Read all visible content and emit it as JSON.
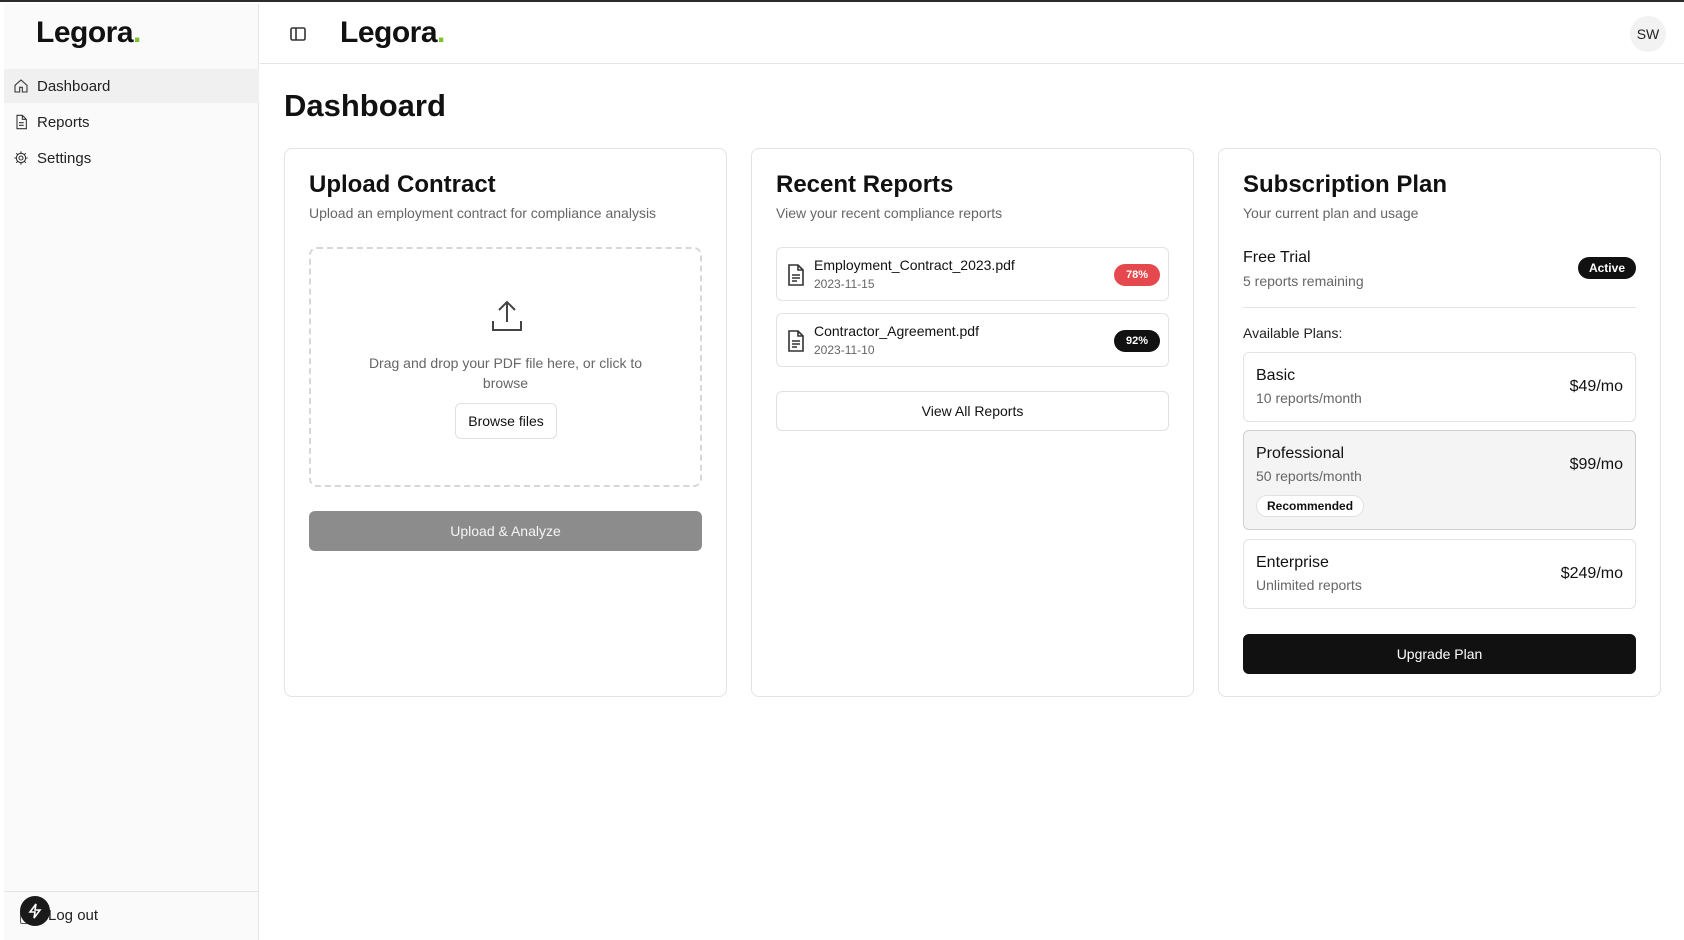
{
  "brand": {
    "name": "Legora",
    "dot": ".",
    "dot_color": "#7bc42c"
  },
  "sidebar": {
    "items": [
      {
        "label": "Dashboard",
        "icon": "home-icon"
      },
      {
        "label": "Reports",
        "icon": "file-text-icon"
      },
      {
        "label": "Settings",
        "icon": "gear-icon"
      }
    ],
    "logout_label": "Log out"
  },
  "topbar": {
    "avatar_initials": "SW"
  },
  "page": {
    "title": "Dashboard"
  },
  "upload": {
    "title": "Upload Contract",
    "description": "Upload an employment contract for compliance analysis",
    "dropzone_text": "Drag and drop your PDF file here, or click to browse",
    "browse_label": "Browse files",
    "submit_label": "Upload & Analyze"
  },
  "reports": {
    "title": "Recent Reports",
    "description": "View your recent compliance reports",
    "items": [
      {
        "name": "Employment_Contract_2023.pdf",
        "date": "2023-11-15",
        "score": "78%",
        "score_color": "#e5484d"
      },
      {
        "name": "Contractor_Agreement.pdf",
        "date": "2023-11-10",
        "score": "92%",
        "score_color": "#111111"
      }
    ],
    "view_all_label": "View All Reports"
  },
  "subscription": {
    "title": "Subscription Plan",
    "description": "Your current plan and usage",
    "current": {
      "name": "Free Trial",
      "remaining": "5 reports remaining",
      "status": "Active"
    },
    "available_label": "Available Plans:",
    "plans": [
      {
        "name": "Basic",
        "desc": "10 reports/month",
        "price": "$49/mo"
      },
      {
        "name": "Professional",
        "desc": "50 reports/month",
        "price": "$99/mo",
        "badge": "Recommended"
      },
      {
        "name": "Enterprise",
        "desc": "Unlimited reports",
        "price": "$249/mo"
      }
    ],
    "upgrade_label": "Upgrade Plan"
  }
}
